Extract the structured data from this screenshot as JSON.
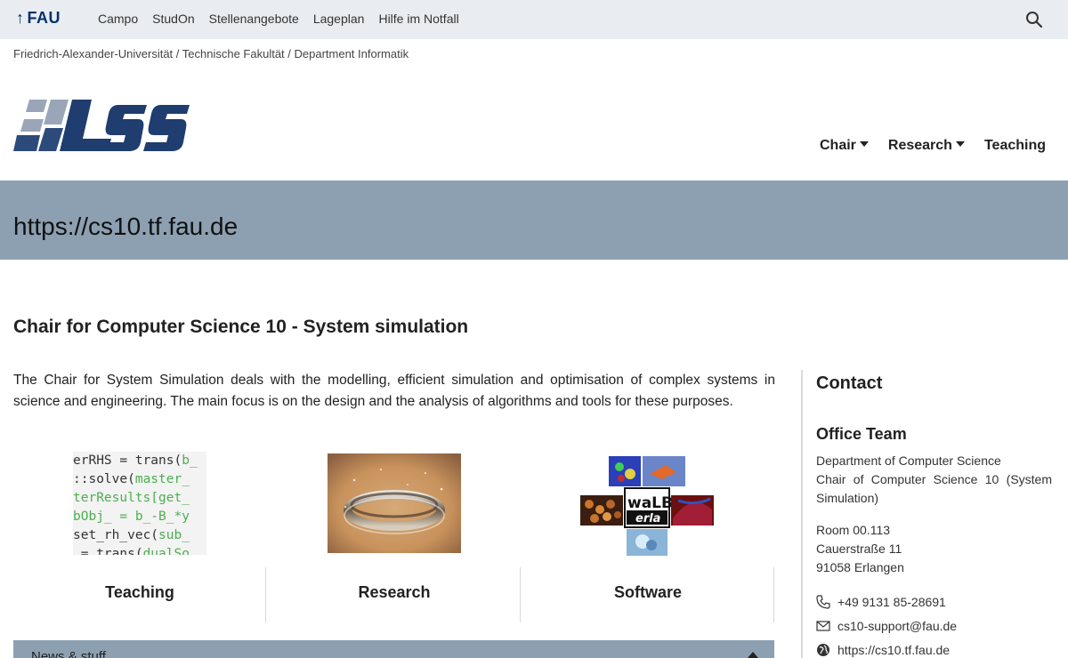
{
  "topbar": {
    "logo": "FAU",
    "nav": [
      "Campo",
      "StudOn",
      "Stellenangebote",
      "Lageplan",
      "Hilfe im Notfall"
    ]
  },
  "breadcrumb": "Friedrich-Alexander-Universität / Technische Fakultät / Department Informatik",
  "main_nav": [
    {
      "label": "Chair",
      "dropdown": true
    },
    {
      "label": "Research",
      "dropdown": true
    },
    {
      "label": "Teaching",
      "dropdown": false
    }
  ],
  "banner": {
    "title": "https://cs10.tf.fau.de"
  },
  "page": {
    "title": "Chair for Computer Science 10 - System simulation",
    "intro": "The Chair for System Simulation deals with the modelling, efficient simulation and optimisation of complex systems in science and engineering. The main focus is on the design and the analysis of algorithms and tools for these purposes."
  },
  "teasers": [
    {
      "label": "Teaching",
      "code_lines": [
        [
          "erRHS = trans(",
          "b_"
        ],
        [
          "::solve(",
          "master_"
        ],
        [
          "",
          "terResults[get_"
        ],
        [
          "",
          "bObj_ = b_-B_*y"
        ],
        [
          "set_rh_vec(",
          "sub_"
        ],
        [
          " = trans(",
          "dualSo"
        ]
      ]
    },
    {
      "label": "Research"
    },
    {
      "label": "Software",
      "logo_text": "waLB erla"
    }
  ],
  "sidebar": {
    "contact_title": "Contact",
    "office_title": "Office Team",
    "dept": "Department of Computer Science",
    "chair": "Chair of Computer Science 10 (System Simulation)",
    "room": "Room 00.113",
    "street": "Cauerstraße 11",
    "city": "91058 Erlangen",
    "phone": "+49 9131 85-28691",
    "email": "cs10-support@fau.de",
    "web": "https://cs10.tf.fau.de"
  },
  "news": {
    "title": "News & stuff"
  },
  "colors": {
    "fau_blue": "#04316a",
    "banner": "#8da0b2",
    "code_green": "#4caf50"
  }
}
